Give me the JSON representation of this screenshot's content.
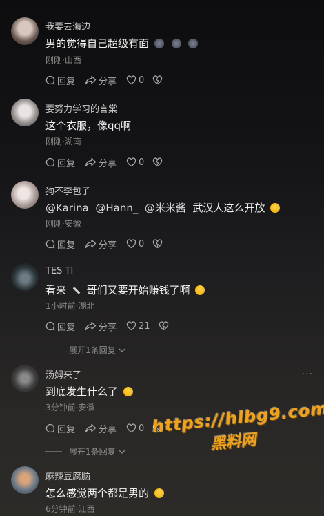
{
  "comments": [
    {
      "username": "我要去海边",
      "text": "男的觉得自己超级有面",
      "meta": "刚刚·山西",
      "reply": "回复",
      "share": "分享",
      "likes": "0"
    },
    {
      "username": "要努力学习的言棠",
      "text": "这个衣服，像qq啊",
      "meta": "刚刚·湖南",
      "reply": "回复",
      "share": "分享",
      "likes": "0"
    },
    {
      "username": "狗不李包子",
      "mentions": [
        "@Karina",
        "@Hann_",
        "@米米酱"
      ],
      "text": "武汉人这么开放",
      "meta": "刚刚·安徽",
      "reply": "回复",
      "share": "分享",
      "likes": "0"
    },
    {
      "username": "TES TI",
      "text_a": "看来",
      "text_b": "哥们又要开始赚钱了啊",
      "meta": "1小时前·湖北",
      "reply": "回复",
      "share": "分享",
      "likes": "21",
      "expand": "展开1条回复"
    },
    {
      "username": "汤姆来了",
      "text": "到底发生什么了",
      "meta": "3分钟前·安徽",
      "more": "···",
      "reply": "回复",
      "share": "分享",
      "likes": "0",
      "expand": "展开1条回复"
    },
    {
      "username": "麻辣豆腐脑",
      "text": "怎么感觉两个都是男的",
      "meta": "6分钟前·江西"
    }
  ],
  "watermark": {
    "line1": "https://hlbg9.com",
    "line2": "黑料网"
  },
  "icons": {
    "reply": "comment-bubble-icon",
    "share": "share-arrow-icon",
    "like": "heart-icon",
    "dislike": "broken-heart-icon",
    "expand": "chevron-down-icon"
  }
}
